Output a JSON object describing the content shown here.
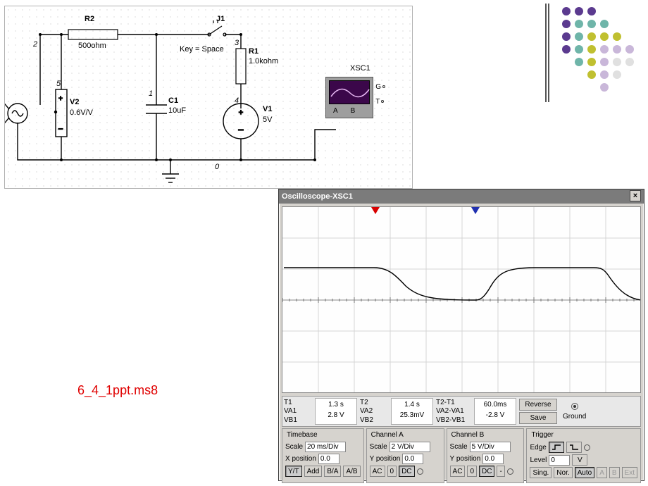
{
  "decorative_palette": [
    "#5b3a8f",
    "#6fb5a9",
    "#c0c030",
    "#c9b7d9",
    "#e0e0e0"
  ],
  "schematic": {
    "components": {
      "R2": {
        "label": "R2",
        "value": "500ohm",
        "node_left": "2"
      },
      "J1": {
        "label": "J1",
        "key_hint": "Key = Space"
      },
      "R1": {
        "label": "R1",
        "value": "1.0kohm",
        "node_top": "3"
      },
      "C1": {
        "label": "C1",
        "value": "10uF",
        "node_top": "1"
      },
      "V2": {
        "label": "V2",
        "value": "0.6V/V",
        "node_top": "5"
      },
      "V1": {
        "label": "V1",
        "value": "5V",
        "node_top": "4"
      },
      "XSC1": {
        "label": "XSC1",
        "termA": "A",
        "termB": "B",
        "termG": "G",
        "termT": "T"
      }
    },
    "ground_node": "0"
  },
  "caption": "6_4_1ppt.ms8",
  "oscilloscope_window": {
    "title": "Oscilloscope-XSC1",
    "close_glyph": "×",
    "cursors": {
      "T1_color": "#d80000",
      "T2_color": "#2030b0"
    },
    "readouts": {
      "T1": {
        "labels": [
          "T1",
          "VA1",
          "VB1"
        ],
        "values": [
          "1.3 s",
          "2.8 V",
          ""
        ]
      },
      "T2": {
        "labels": [
          "T2",
          "VA2",
          "VB2"
        ],
        "values": [
          "1.4 s",
          "25.3mV",
          ""
        ]
      },
      "dT": {
        "labels": [
          "T2-T1",
          "VA2-VA1",
          "VB2-VB1"
        ],
        "values": [
          "60.0ms",
          "-2.8 V",
          ""
        ]
      },
      "buttons": {
        "reverse": "Reverse",
        "save": "Save"
      },
      "ground_label": "Ground"
    },
    "timebase": {
      "title": "Timebase",
      "scale_label": "Scale",
      "scale_value": "20 ms/Div",
      "xpos_label": "X position",
      "xpos_value": "0.0",
      "buttons": [
        "Y/T",
        "Add",
        "B/A",
        "A/B"
      ],
      "pressed": "Y/T"
    },
    "channelA": {
      "title": "Channel A",
      "scale_label": "Scale",
      "scale_value": "2 V/Div",
      "ypos_label": "Y position",
      "ypos_value": "0.0",
      "buttons": [
        "AC",
        "0",
        "DC"
      ],
      "pressed": "DC"
    },
    "channelB": {
      "title": "Channel B",
      "scale_label": "Scale",
      "scale_value": "5 V/Div",
      "ypos_label": "Y position",
      "ypos_value": "0.0",
      "buttons": [
        "AC",
        "0",
        "DC",
        "-"
      ],
      "pressed": "DC"
    },
    "trigger": {
      "title": "Trigger",
      "edge_label": "Edge",
      "level_label": "Level",
      "level_value": "0",
      "level_unit": "V",
      "buttons": [
        "Sing.",
        "Nor.",
        "Auto",
        "A",
        "B",
        "Ext"
      ],
      "pressed": "Auto"
    }
  }
}
